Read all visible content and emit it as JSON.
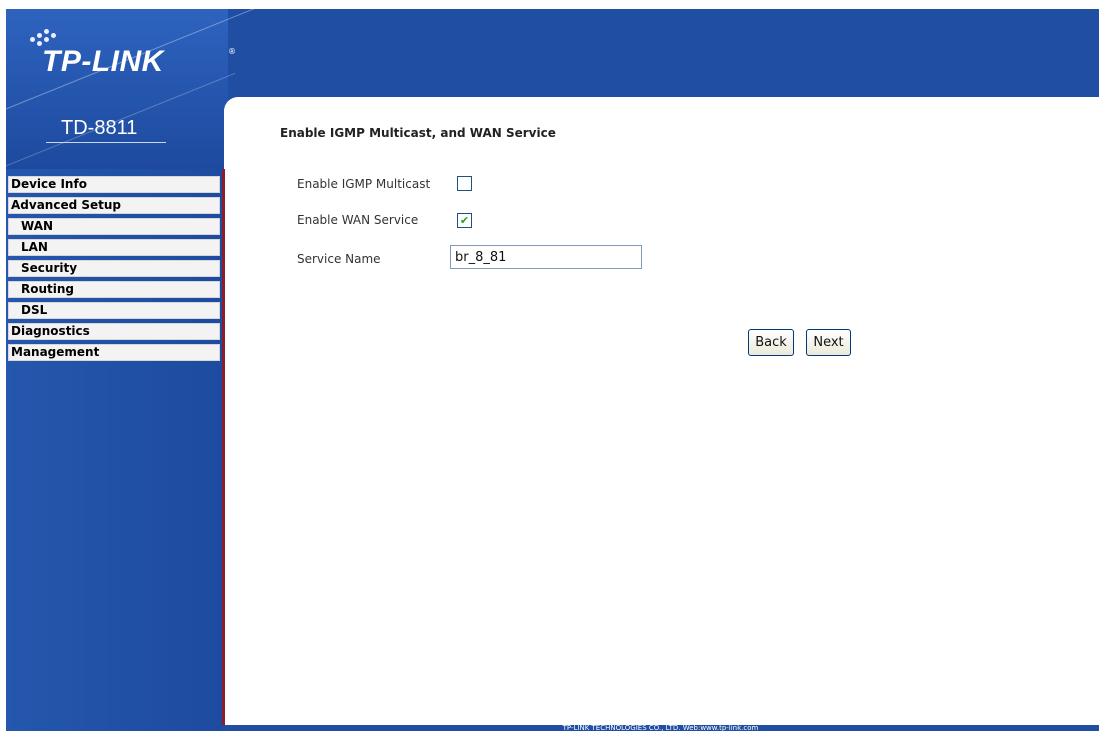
{
  "brand": {
    "logo": "TP-LINK",
    "model": "TD-8811"
  },
  "sidebar": {
    "items": [
      {
        "label": "Device Info",
        "sub": false
      },
      {
        "label": "Advanced Setup",
        "sub": false
      },
      {
        "label": "WAN",
        "sub": true
      },
      {
        "label": "LAN",
        "sub": true
      },
      {
        "label": "Security",
        "sub": true
      },
      {
        "label": "Routing",
        "sub": true
      },
      {
        "label": "DSL",
        "sub": true
      },
      {
        "label": "Diagnostics",
        "sub": false
      },
      {
        "label": "Management",
        "sub": false
      }
    ]
  },
  "page": {
    "heading": "Enable IGMP Multicast, and WAN Service",
    "igmp": {
      "label": "Enable IGMP Multicast",
      "checked": false
    },
    "wan": {
      "label": "Enable WAN Service",
      "checked": true
    },
    "service_name": {
      "label": "Service Name",
      "value": "br_8_81"
    },
    "back_label": "Back",
    "next_label": "Next"
  },
  "footer": {
    "text": "TP-LINK TECHNOLOGIES CO., LTD. Web:www.tp-link.com"
  },
  "colors": {
    "header_blue": "#1f4ea3",
    "sidebar_border": "#8a1d2e"
  }
}
